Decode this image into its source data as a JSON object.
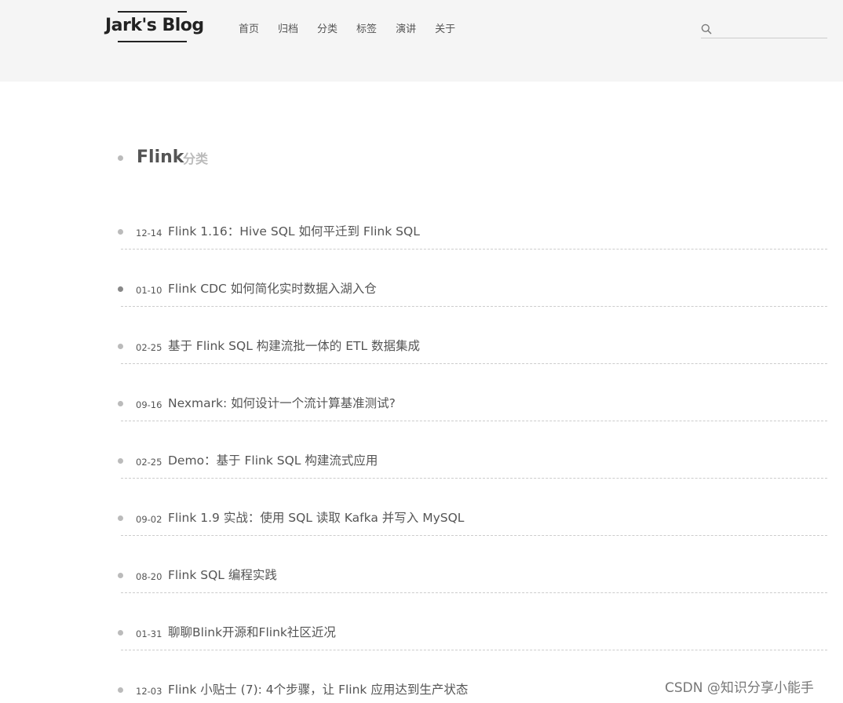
{
  "header": {
    "brand": "Jark's Blog",
    "nav": [
      "首页",
      "归档",
      "分类",
      "标签",
      "演讲",
      "关于"
    ],
    "search": {
      "value": "",
      "placeholder": "",
      "icon": "search-icon"
    }
  },
  "category": {
    "name": "Flink",
    "suffix": "分类"
  },
  "posts": [
    {
      "date": "12-14",
      "title": "Flink 1.16：Hive SQL 如何平迁到 Flink SQL"
    },
    {
      "date": "01-10",
      "title": "Flink CDC 如何简化实时数据入湖入仓"
    },
    {
      "date": "02-25",
      "title": "基于 Flink SQL 构建流批一体的 ETL 数据集成"
    },
    {
      "date": "09-16",
      "title": "Nexmark: 如何设计一个流计算基准测试?"
    },
    {
      "date": "02-25",
      "title": "Demo：基于 Flink SQL 构建流式应用"
    },
    {
      "date": "09-02",
      "title": "Flink 1.9 实战：使用 SQL 读取 Kafka 并写入 MySQL"
    },
    {
      "date": "08-20",
      "title": "Flink SQL 编程实践"
    },
    {
      "date": "01-31",
      "title": "聊聊Blink开源和Flink社区近况"
    },
    {
      "date": "12-03",
      "title": "Flink 小贴士 (7): 4个步骤，让 Flink 应用达到生产状态"
    }
  ],
  "watermark": "CSDN @知识分享小能手",
  "colors": {
    "header_bg": "#f5f5f5",
    "text": "#555555",
    "muted": "#bbbbbb",
    "divider": "#cccccc"
  }
}
